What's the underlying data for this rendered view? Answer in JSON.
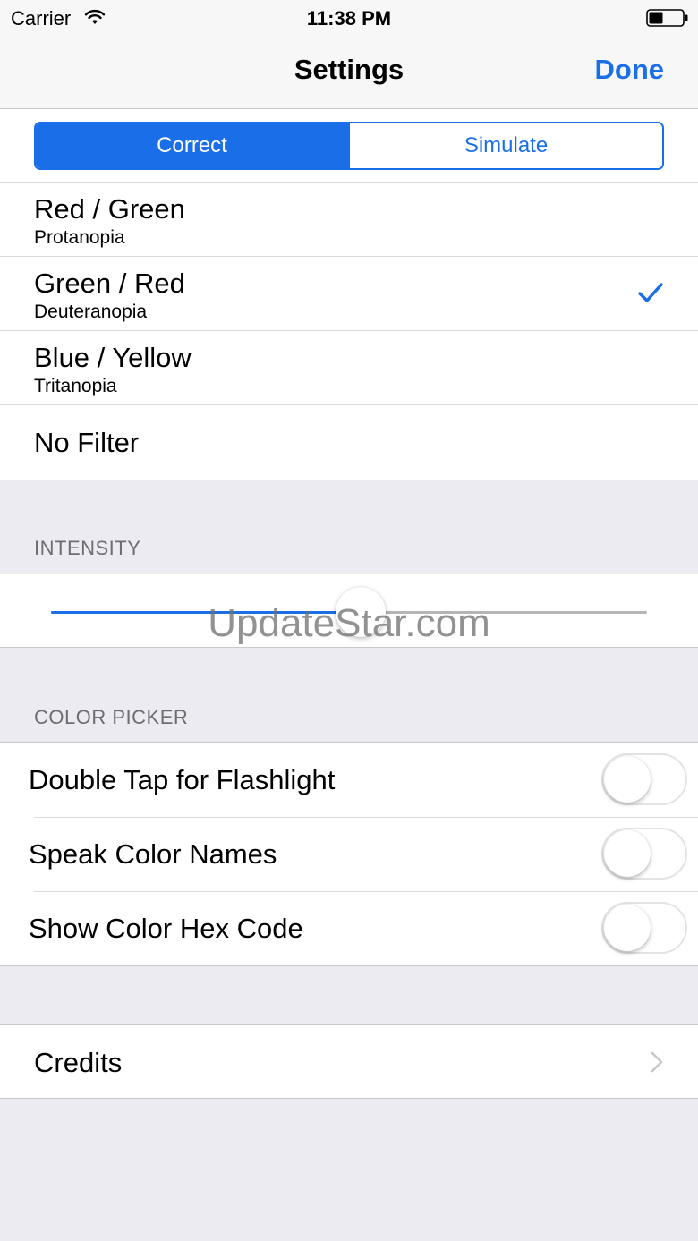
{
  "status_bar": {
    "carrier": "Carrier",
    "time": "11:38 PM"
  },
  "nav": {
    "title": "Settings",
    "done_label": "Done"
  },
  "segment": {
    "options": [
      "Correct",
      "Simulate"
    ],
    "selected": "Correct"
  },
  "filters": [
    {
      "title": "Red / Green",
      "subtitle": "Protanopia",
      "checked": false
    },
    {
      "title": "Green / Red",
      "subtitle": "Deuteranopia",
      "checked": true
    },
    {
      "title": "Blue / Yellow",
      "subtitle": "Tritanopia",
      "checked": false
    },
    {
      "title": "No Filter",
      "subtitle": "",
      "checked": false
    }
  ],
  "intensity": {
    "header": "INTENSITY",
    "value_fraction": 0.52
  },
  "color_picker": {
    "header": "COLOR PICKER",
    "toggles": [
      {
        "label": "Double Tap for Flashlight",
        "on": false
      },
      {
        "label": "Speak Color Names",
        "on": false
      },
      {
        "label": "Show Color Hex Code",
        "on": false
      }
    ]
  },
  "credits": {
    "label": "Credits"
  },
  "watermark": "UpdateStar.com",
  "colors": {
    "accent": "#1A6FE8",
    "background": "#EBEBF1",
    "section_header": "#6D6D72"
  }
}
